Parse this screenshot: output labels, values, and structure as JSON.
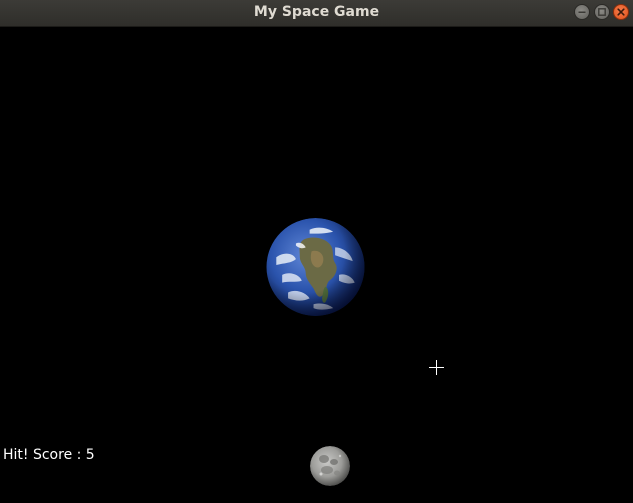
{
  "window": {
    "title": "My Space Game",
    "controls": {
      "minimize_icon": "minimize-icon",
      "maximize_icon": "maximize-icon",
      "close_icon": "close-icon"
    }
  },
  "game": {
    "score_label": "Hit! Score : 5",
    "sprites": {
      "planet": "earth-icon",
      "moon": "moon-icon",
      "cursor": "crosshair-icon"
    },
    "colors": {
      "background": "#000000",
      "score_text": "#ffffff",
      "close_button": "#e95420"
    }
  }
}
